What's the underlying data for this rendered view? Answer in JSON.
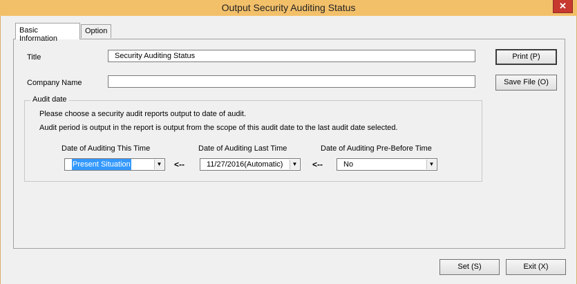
{
  "window": {
    "title": "Output Security Auditing Status",
    "close_glyph": "✕"
  },
  "tabs": [
    {
      "label": "Basic Information",
      "active": true
    },
    {
      "label": "Option",
      "active": false
    }
  ],
  "form": {
    "title_label": "Title",
    "title_value": "Security Auditing Status",
    "company_label": "Company Name",
    "company_value": ""
  },
  "audit": {
    "group_label": "Audit date",
    "info_line1": "Please choose a security audit reports output to date of audit.",
    "info_line2": "Audit period is output in the report is output from the scope of this audit date to the last audit date selected.",
    "this_time_label": "Date of Auditing This Time",
    "this_time_value": "Present Situation",
    "last_time_label": "Date of Auditing Last Time",
    "last_time_value": "11/27/2016(Automatic)",
    "pre_before_label": "Date of Auditing Pre-Before Time",
    "pre_before_value": "No",
    "arrow": "<--",
    "dropdown_glyph": "▼"
  },
  "buttons": {
    "print": "Print (P)",
    "save_file": "Save File (O)",
    "set": "Set (S)",
    "exit": "Exit (X)"
  }
}
